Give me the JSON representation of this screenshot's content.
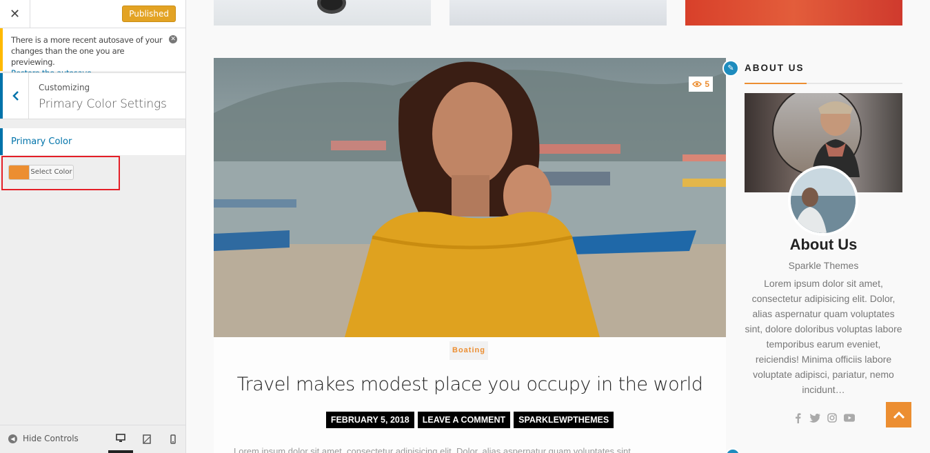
{
  "customizer": {
    "close_label": "✕",
    "publish_label": "Published",
    "notice": {
      "text": "There is a more recent autosave of your changes than the one you are previewing.",
      "link": "Restore the autosave"
    },
    "breadcrumb": "Customizing",
    "section_title": "Primary Color Settings",
    "control_label": "Primary Color",
    "color_button_label": "Select Color",
    "color_value": "#ec8e31",
    "footer": {
      "hide_controls": "Hide Controls"
    }
  },
  "preview": {
    "post": {
      "views": "5",
      "category": "Boating",
      "title": "Travel makes modest place you occupy in the world",
      "meta": [
        "FEBRUARY 5, 2018",
        "LEAVE A COMMENT",
        "SPARKLEWPTHEMES"
      ],
      "excerpt": "Lorem ipsum dolor sit amet, consectetur adipisicing elit. Dolor, alias aspernatur quam voluptates sint,"
    },
    "sidebar": {
      "widget_title": "ABOUT US",
      "name": "About Us",
      "subtitle": "Sparkle Themes",
      "text": "Lorem ipsum dolor sit amet, consectetur adipisicing elit. Dolor, alias aspernatur quam voluptates sint, dolore doloribus voluptas labore temporibus earum eveniet, reiciendis! Minima officiis labore voluptate adipisci, pariatur, nemo incidunt…",
      "social": [
        "facebook-icon",
        "twitter-icon",
        "instagram-icon",
        "youtube-icon"
      ]
    },
    "accent_color": "#ec8e31"
  }
}
